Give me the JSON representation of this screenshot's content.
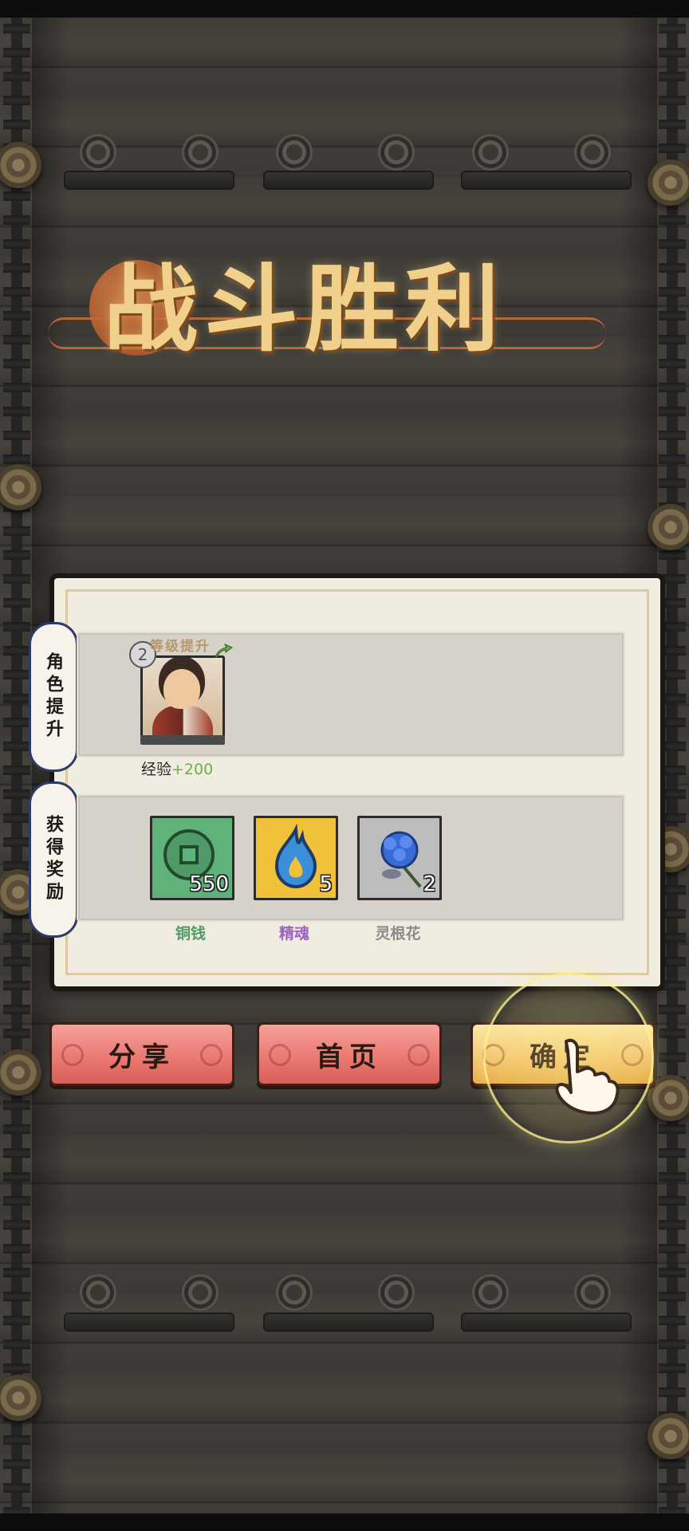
{
  "title": "战斗胜利",
  "sections": {
    "character": {
      "label": "角色提升",
      "level": "2",
      "levelup_label": "等级提升",
      "exp_label": "经验",
      "exp_gain": "+200"
    },
    "rewards": {
      "label": "获得奖励",
      "items": [
        {
          "name": "铜钱",
          "count": "550",
          "icon": "copper-coin-icon",
          "bg": "#5fb37a",
          "name_color": "#4f9a66"
        },
        {
          "name": "精魂",
          "count": "5",
          "icon": "blue-flame-icon",
          "bg": "#f2c13a",
          "name_color": "#9a64c0"
        },
        {
          "name": "灵根花",
          "count": "2",
          "icon": "blue-flower-icon",
          "bg": "#bdbdbd",
          "name_color": "#8a8a8a"
        }
      ]
    }
  },
  "buttons": {
    "share": "分享",
    "home": "首页",
    "confirm": "确定"
  },
  "colors": {
    "accent_gold": "#f0d08a",
    "button_red": "#e9776f",
    "button_gold": "#f2c570",
    "tag_border": "#2a3a6a"
  }
}
